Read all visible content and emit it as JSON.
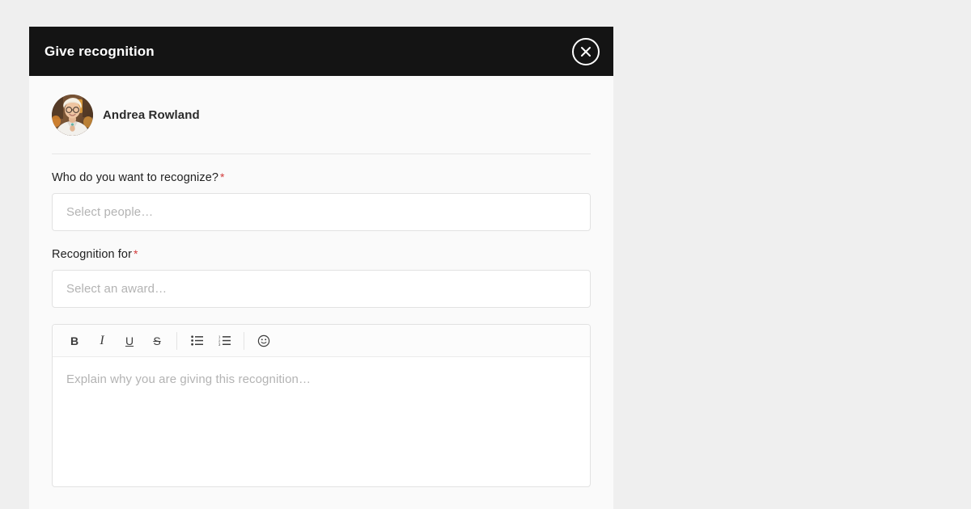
{
  "page": {
    "background_color": "#efefef"
  },
  "modal": {
    "background_color": "#fafafa",
    "header": {
      "title": "Give recognition",
      "background_color": "#141414",
      "text_color": "#ffffff",
      "close_icon": "close-circle-icon"
    },
    "author": {
      "name": "Andrea Rowland",
      "avatar_icon": "user-photo-avatar"
    },
    "fields": [
      {
        "label": "Who do you want to recognize?",
        "required": true,
        "required_marker": "*",
        "placeholder": "Select people…",
        "value": ""
      },
      {
        "label": "Recognition for",
        "required": true,
        "required_marker": "*",
        "placeholder": "Select an award…",
        "value": ""
      }
    ],
    "editor": {
      "placeholder": "Explain why you are giving this recognition…",
      "value": "",
      "toolbar": [
        {
          "name": "bold",
          "icon": "bold-icon",
          "label": "B"
        },
        {
          "name": "italic",
          "icon": "italic-icon",
          "label": "I"
        },
        {
          "name": "underline",
          "icon": "underline-icon",
          "label": "U"
        },
        {
          "name": "strikethrough",
          "icon": "strikethrough-icon",
          "label": "S"
        },
        {
          "name": "bulleted-list",
          "icon": "bulleted-list-icon",
          "label": ""
        },
        {
          "name": "numbered-list",
          "icon": "numbered-list-icon",
          "label": ""
        },
        {
          "name": "emoji",
          "icon": "emoji-smiley-icon",
          "label": ""
        }
      ]
    },
    "colors": {
      "required_asterisk": "#d23b3b",
      "placeholder_text": "#b3b3b3",
      "border": "#e2e2e2",
      "divider": "#e6e6e6"
    }
  }
}
